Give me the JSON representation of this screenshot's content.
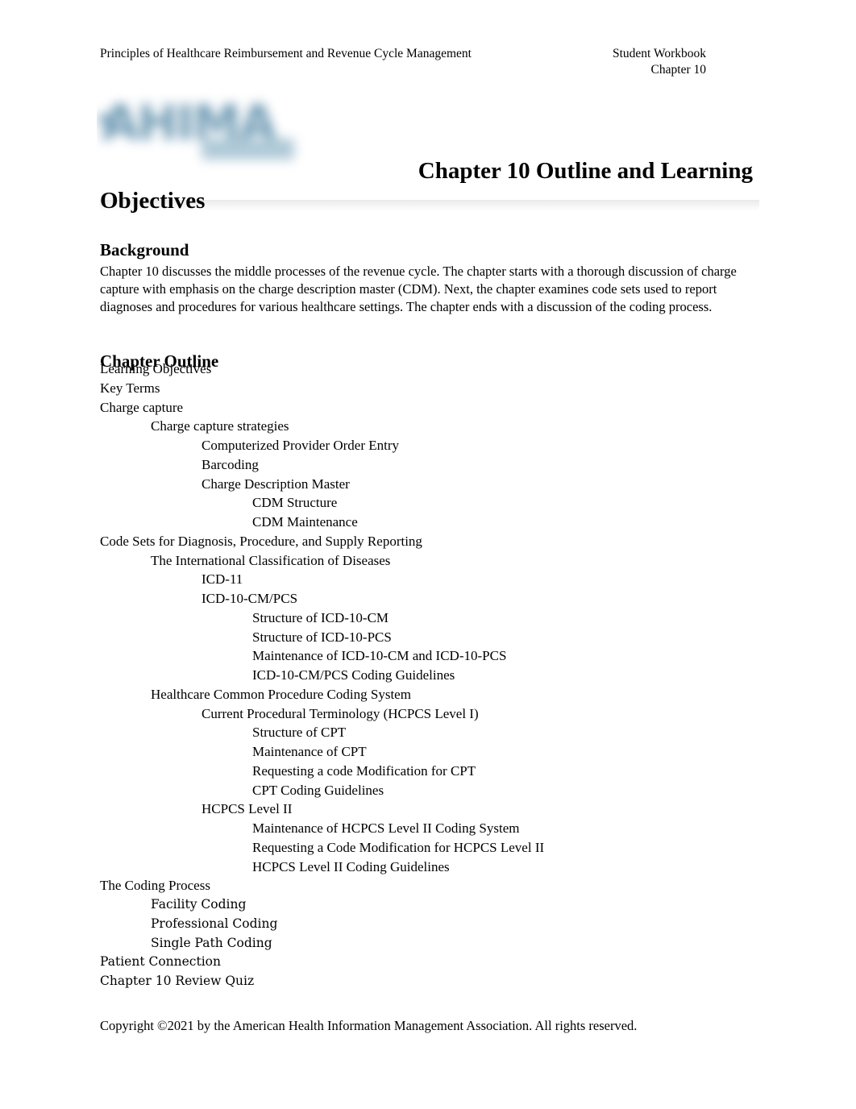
{
  "header": {
    "left_text": "Principles of Healthcare Reimbursement and Revenue Cycle Management",
    "right_line1": "Student Workbook",
    "right_line2": "Chapter 10"
  },
  "logo": {
    "name": "ahima-logo",
    "wordmark": "AHIMA",
    "color": "#5f8fab",
    "state": "blurred"
  },
  "title": {
    "line1": "Chapter 10 Outline and Learning",
    "line2": "Objectives"
  },
  "background": {
    "heading": "Background",
    "paragraph": "Chapter 10 discusses the middle processes of the revenue cycle. The chapter starts with a thorough discussion of charge capture with emphasis on the charge description master (CDM). Next, the chapter examines code sets used to report diagnoses and procedures for various healthcare settings. The chapter ends with a discussion of the coding process."
  },
  "chapter_outline": {
    "heading": "Chapter Outline",
    "items": [
      {
        "label": "Learning Objectives",
        "level": 0
      },
      {
        "label": "Key Terms",
        "level": 0
      },
      {
        "label": "Charge capture",
        "level": 0
      },
      {
        "label": "Charge capture strategies",
        "level": 1
      },
      {
        "label": "Computerized Provider Order Entry",
        "level": 2
      },
      {
        "label": "Barcoding",
        "level": 2
      },
      {
        "label": "Charge Description Master",
        "level": 2
      },
      {
        "label": "CDM Structure",
        "level": 3
      },
      {
        "label": "CDM Maintenance",
        "level": 3
      },
      {
        "label": "Code Sets for Diagnosis, Procedure, and Supply Reporting",
        "level": 0
      },
      {
        "label": "The International Classification of Diseases",
        "level": 1
      },
      {
        "label": "ICD-11",
        "level": 2
      },
      {
        "label": "ICD-10-CM/PCS",
        "level": 2
      },
      {
        "label": "Structure of ICD-10-CM",
        "level": 3
      },
      {
        "label": "Structure of ICD-10-PCS",
        "level": 3
      },
      {
        "label": "Maintenance of ICD-10-CM and ICD-10-PCS",
        "level": 3
      },
      {
        "label": "ICD-10-CM/PCS Coding Guidelines",
        "level": 3
      },
      {
        "label": "Healthcare Common Procedure Coding System",
        "level": 1
      },
      {
        "label": "Current Procedural Terminology (HCPCS Level I)",
        "level": 2
      },
      {
        "label": "Structure of CPT",
        "level": 3
      },
      {
        "label": "Maintenance of CPT",
        "level": 3
      },
      {
        "label": "Requesting a code Modification for CPT",
        "level": 3
      },
      {
        "label": "CPT Coding Guidelines",
        "level": 3
      },
      {
        "label": "HCPCS Level II",
        "level": 2
      },
      {
        "label": "Maintenance of HCPCS Level II Coding System",
        "level": 3
      },
      {
        "label": "Requesting a Code Modification for HCPCS Level II",
        "level": 3
      },
      {
        "label": "HCPCS Level II Coding Guidelines",
        "level": 3
      },
      {
        "label": "The Coding Process",
        "level": 0
      },
      {
        "label": "Facility Coding",
        "level": 1,
        "face": "alt"
      },
      {
        "label": "Professional Coding",
        "level": 1,
        "face": "alt"
      },
      {
        "label": "Single Path Coding",
        "level": 1,
        "face": "alt"
      },
      {
        "label": "Patient Connection",
        "level": 0,
        "face": "alt"
      },
      {
        "label": "Chapter 10 Review Quiz",
        "level": 0,
        "face": "alt"
      }
    ]
  },
  "footer": {
    "copyright": "Copyright ©2021 by the American Health Information Management Association. All rights reserved."
  }
}
